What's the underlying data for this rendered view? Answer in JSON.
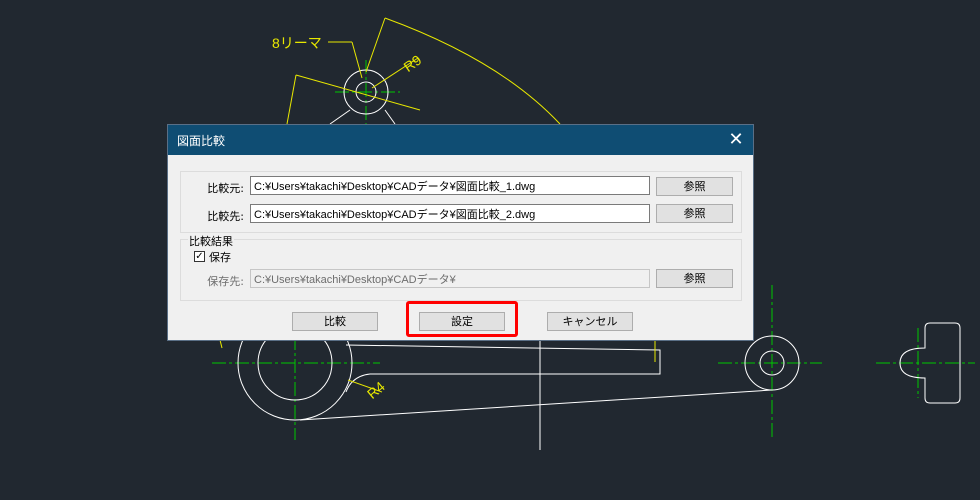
{
  "cad": {
    "reamer_note": "8リーマ",
    "radius_label_top": "R9",
    "radius_label_bottom": "R4",
    "colors": {
      "background": "#212830",
      "outline": "#ffffff",
      "dimension": "#e8e800",
      "centerline": "#00c800"
    }
  },
  "dialog": {
    "title": "図面比較",
    "close_icon": "close-icon",
    "source_label": "比較元:",
    "source_value": "C:¥Users¥takachi¥Desktop¥CADデータ¥図面比較_1.dwg",
    "target_label": "比較先:",
    "target_value": "C:¥Users¥takachi¥Desktop¥CADデータ¥図面比較_2.dwg",
    "browse_label": "参照",
    "result_group_label": "比較結果",
    "save_checkbox_label": "保存",
    "save_checked": true,
    "save_to_label": "保存先:",
    "save_to_value": "C:¥Users¥takachi¥Desktop¥CADデータ¥",
    "compare_button": "比較",
    "settings_button": "設定",
    "cancel_button": "キャンセル",
    "highlight_color": "#ff0000"
  }
}
